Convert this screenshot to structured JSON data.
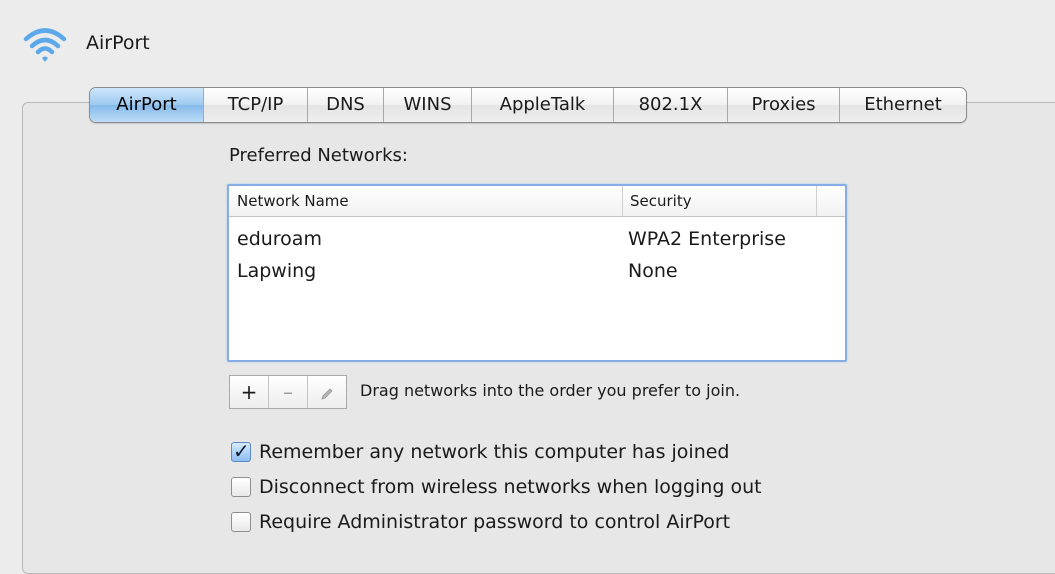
{
  "window": {
    "title": "AirPort",
    "icon": "wifi-icon"
  },
  "tabs": [
    {
      "label": "AirPort",
      "active": true
    },
    {
      "label": "TCP/IP",
      "active": false
    },
    {
      "label": "DNS",
      "active": false
    },
    {
      "label": "WINS",
      "active": false
    },
    {
      "label": "AppleTalk",
      "active": false
    },
    {
      "label": "802.1X",
      "active": false
    },
    {
      "label": "Proxies",
      "active": false
    },
    {
      "label": "Ethernet",
      "active": false
    }
  ],
  "preferred": {
    "label": "Preferred Networks:",
    "columns": [
      "Network Name",
      "Security"
    ],
    "rows": [
      {
        "name": "eduroam",
        "security": "WPA2 Enterprise"
      },
      {
        "name": "Lapwing",
        "security": "None"
      }
    ]
  },
  "controls": {
    "add": "+",
    "remove": "–",
    "edit_icon": "pencil-icon",
    "hint": "Drag networks into the order you prefer to join."
  },
  "options": [
    {
      "label": "Remember any network this computer has joined",
      "checked": true
    },
    {
      "label": "Disconnect from wireless networks when logging out",
      "checked": false
    },
    {
      "label": "Require Administrator password to control AirPort",
      "checked": false
    }
  ],
  "colors": {
    "accent": "#86aee3",
    "active_tab": "#9cc9f0"
  }
}
